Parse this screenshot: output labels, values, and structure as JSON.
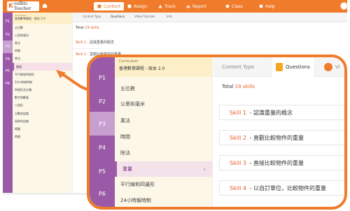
{
  "topbar": {
    "logo_k": "K",
    "logo_rest": "ooBits Teacher",
    "nav": [
      {
        "label": "Content",
        "active": true
      },
      {
        "label": "Assign",
        "active": false
      },
      {
        "label": "Track",
        "active": false
      },
      {
        "label": "Report",
        "active": false
      },
      {
        "label": "Class",
        "active": false
      },
      {
        "label": "Help",
        "active": false
      }
    ]
  },
  "grades": [
    "P1",
    "P2",
    "P3",
    "P4",
    "P5",
    "P6"
  ],
  "selected_grade": "P3",
  "curriculum": {
    "label": "Curriculum",
    "title": "香港數學課程 - 版本 2.0"
  },
  "topics": [
    "五位數",
    "公里和毫米",
    "乘法",
    "時間",
    "除法",
    "重量",
    "平行線和四邊形",
    "24小時報時制",
    "四邊形及分類",
    "數字和數量",
    "三角形",
    "分數的認識",
    "周界的認識",
    "棒圖",
    "時間"
  ],
  "selected_topic": "重量",
  "tabs": {
    "content_type": "Content Type",
    "questions": "Questions",
    "video": "Video Tutorials",
    "video_short": "Vi",
    "info": "Info"
  },
  "total": {
    "label": "Total",
    "count": "19 skills"
  },
  "skills": [
    {
      "num": "Skill 1",
      "name": "認識重量的概念"
    },
    {
      "num": "Skill 2",
      "name": "直觀比較物件的重量"
    },
    {
      "num": "Skill 3",
      "name": "直接比較物件的重量"
    },
    {
      "num": "Skill 4",
      "name": "以自訂單位，比較物件的重量"
    }
  ],
  "colors": {
    "accent": "#f07b2b",
    "grade_sidebar": "#9b5aa8",
    "skill_number": "#e85c2b"
  }
}
